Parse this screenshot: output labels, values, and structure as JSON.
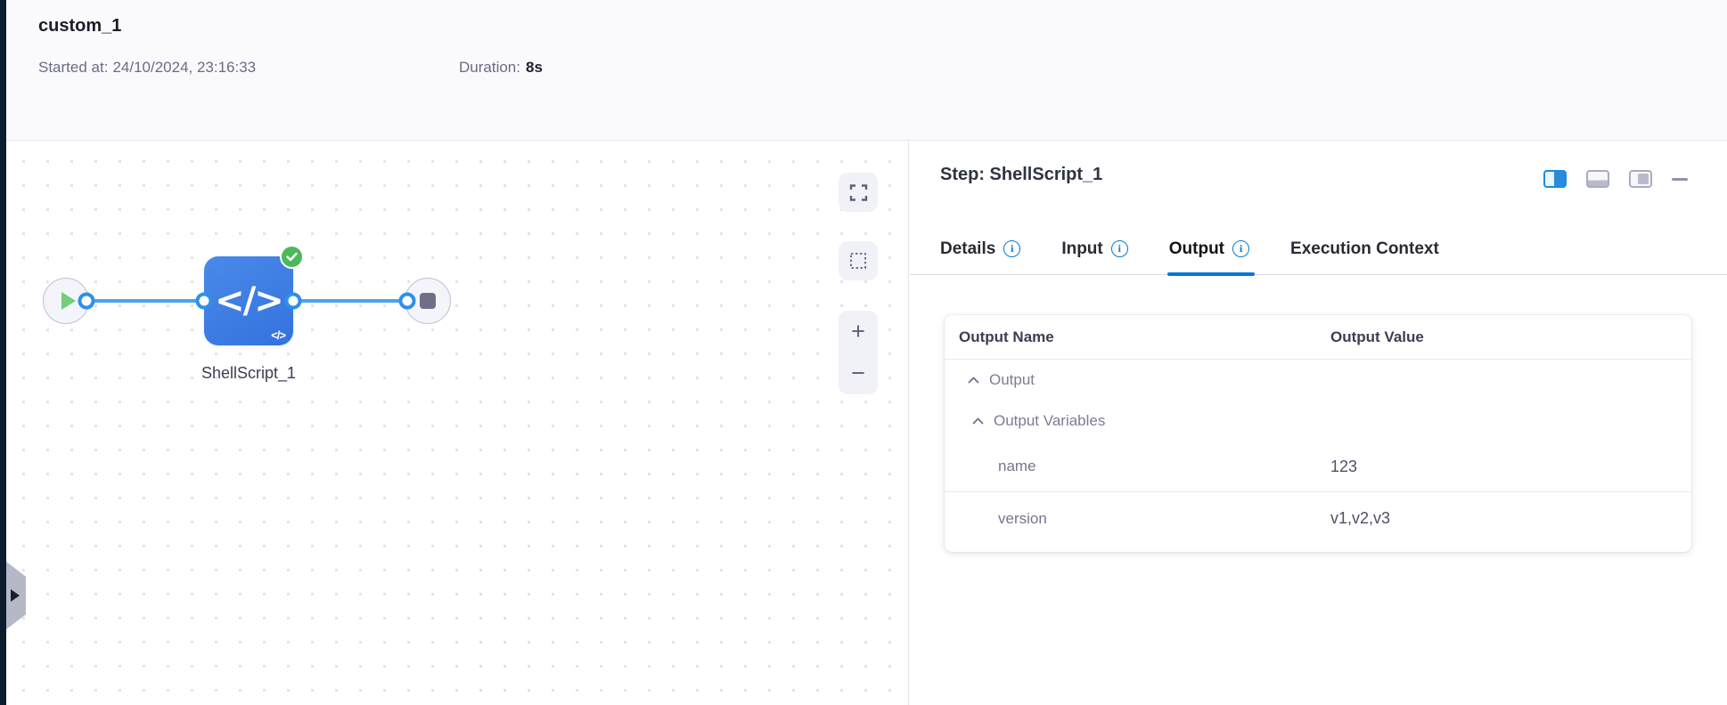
{
  "header": {
    "title": "custom_1",
    "started_label": "Started at:",
    "started_value": "24/10/2024, 23:16:33",
    "duration_label": "Duration:",
    "duration_value": "8s"
  },
  "canvas": {
    "node": {
      "label": "ShellScript_1",
      "icon_glyph": "</>",
      "status": "success"
    },
    "controls": {
      "zoom_in": "+",
      "zoom_out": "−"
    }
  },
  "panel": {
    "title": "Step: ShellScript_1",
    "info_glyph": "i",
    "tabs": [
      {
        "label": "Details",
        "info": true,
        "active": false
      },
      {
        "label": "Input",
        "info": true,
        "active": false
      },
      {
        "label": "Output",
        "info": true,
        "active": true
      },
      {
        "label": "Execution Context",
        "info": false,
        "active": false
      }
    ],
    "table": {
      "columns": [
        "Output Name",
        "Output Value"
      ],
      "groups": [
        {
          "label": "Output",
          "expanded": true
        },
        {
          "label": "Output Variables",
          "expanded": true
        }
      ],
      "rows": [
        {
          "name": "name",
          "value": "123"
        },
        {
          "name": "version",
          "value": "v1,v2,v3"
        }
      ]
    }
  },
  "colors": {
    "accent_blue": "#0278d5",
    "node_blue": "#3a7de2",
    "edge_blue": "#4da3ef",
    "success_green": "#4cb85c",
    "rail_dark": "#0c1c2e"
  }
}
